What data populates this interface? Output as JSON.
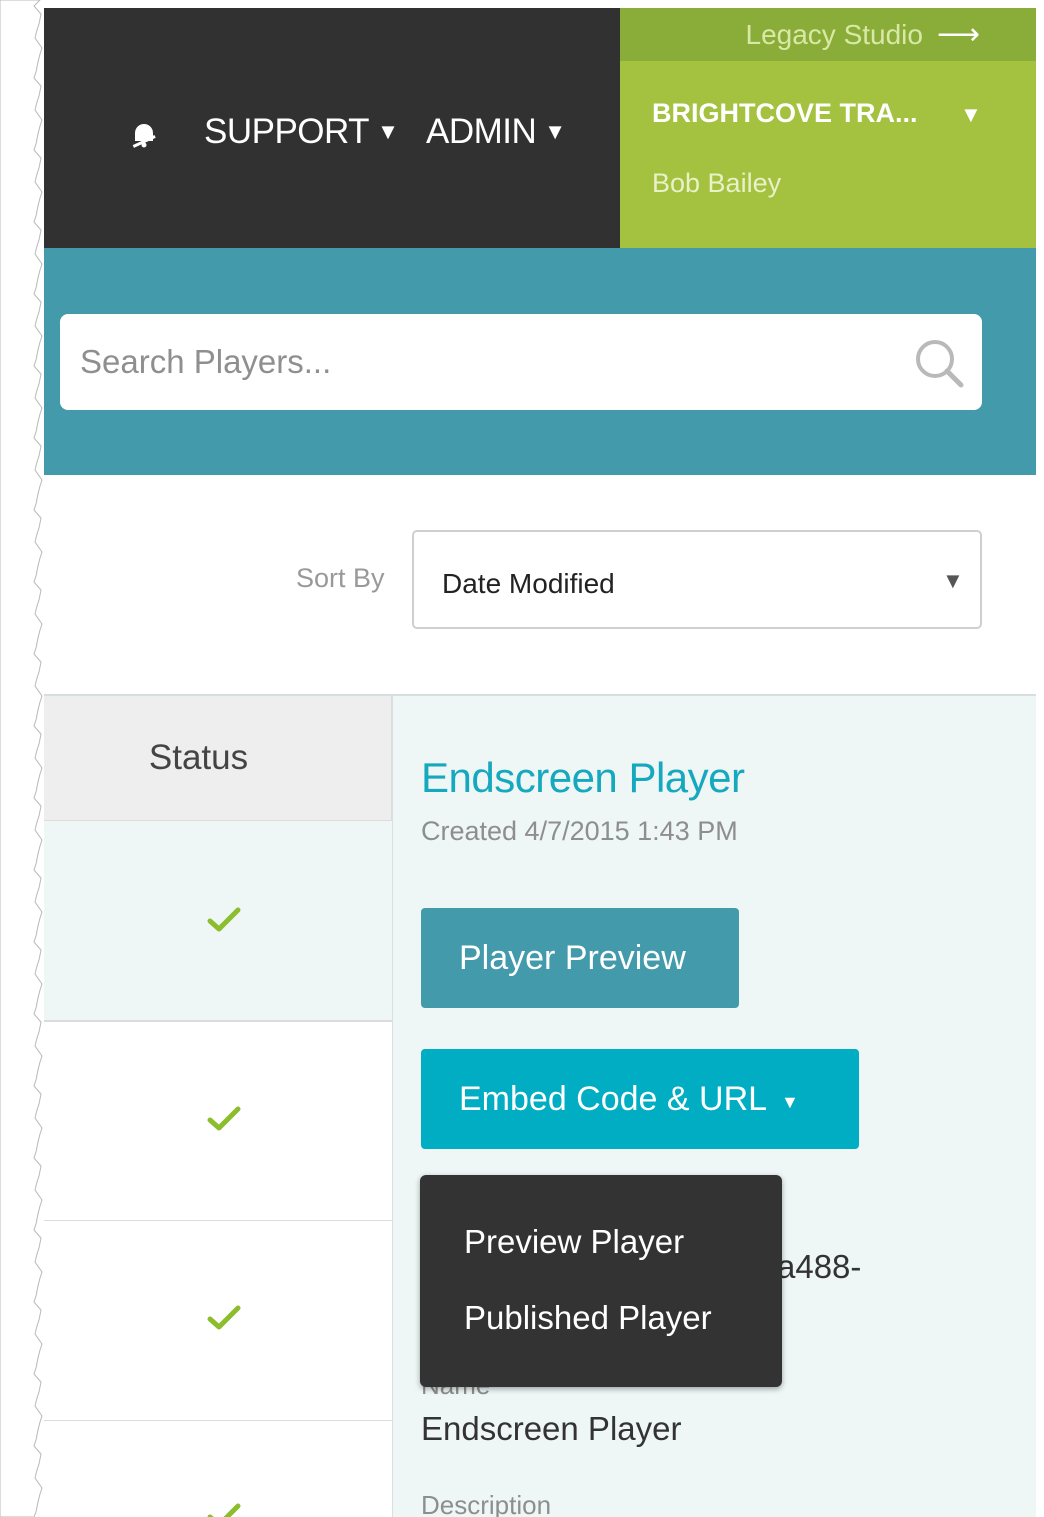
{
  "colors": {
    "topbar": "#313131",
    "account_bg": "#a4c13f",
    "legacy_bg": "#8aac38",
    "search_band": "#429aab",
    "link": "#16a8bf",
    "preview_button": "#429aab",
    "embed_button": "#00adc2",
    "check": "#8cbd2c",
    "dropdown": "#333333"
  },
  "header": {
    "bell_icon": "bell-icon",
    "nav": [
      {
        "label": "SUPPORT",
        "icon": "caret-down-icon"
      },
      {
        "label": "ADMIN",
        "icon": "caret-down-icon"
      }
    ],
    "legacy_link": "Legacy Studio",
    "account_name": "BRIGHTCOVE TRA...",
    "user_name": "Bob Bailey"
  },
  "search": {
    "placeholder": "Search Players...",
    "icon": "search-icon"
  },
  "sort": {
    "label": "Sort By",
    "value": "Date Modified"
  },
  "table": {
    "status_header": "Status",
    "rows": [
      {
        "status": "published",
        "icon": "check-icon"
      },
      {
        "status": "published",
        "icon": "check-icon"
      },
      {
        "status": "published",
        "icon": "check-icon"
      },
      {
        "status": "published",
        "icon": "check-icon"
      }
    ]
  },
  "details": {
    "title": "Endscreen Player",
    "created": "Created 4/7/2015 1:43 PM",
    "preview_button": "Player Preview",
    "embed_button": "Embed Code & URL",
    "id_fragment": "a488-",
    "name_label": "Name",
    "name_value": "Endscreen Player",
    "description_label": "Description"
  },
  "dropdown": {
    "items": [
      "Preview Player",
      "Published Player"
    ]
  }
}
